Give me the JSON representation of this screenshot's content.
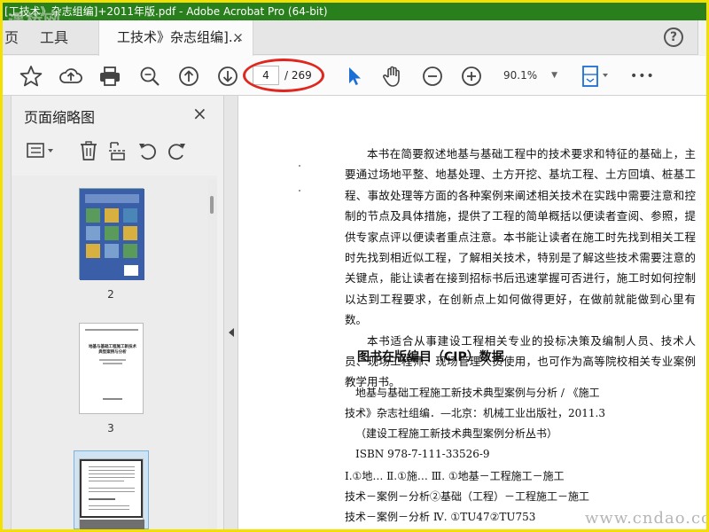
{
  "window": {
    "title": "[工技术》杂志组编]+2011年版.pdf - Adobe Acrobat Pro (64-bit)",
    "watermark_top": "遇桥网"
  },
  "tabs": {
    "home_partial": "页",
    "tools": "工具",
    "document": "工技术》杂志组编]...",
    "close": "×",
    "help": "?"
  },
  "toolbar": {
    "page_current": "4",
    "page_total": "/ 269",
    "zoom": "90.1%",
    "zoom_caret": "▼",
    "more": "•••"
  },
  "sidebar": {
    "title": "页面缩略图",
    "close": "×",
    "thumbnails": [
      {
        "label": "2"
      },
      {
        "label": "3"
      },
      {
        "label": ""
      }
    ],
    "thumb3_lines": [
      "地基与基础工程施工新技术",
      "典型案例与分析"
    ]
  },
  "document": {
    "paragraph1": "本书在简要叙述地基与基础工程中的技术要求和特征的基础上，主要通过场地平整、地基处理、土方开挖、基坑工程、土方回填、桩基工程、事故处理等方面的各种案例来阐述相关技术在实践中需要注意和控制的节点及具体措施，提供了工程的简单概括以便读者查阅、参照，提供专家点评以便读者重点注意。本书能让读者在施工时先找到相关工程时先找到相近似工程，了解相关技术，特别是了解这些技术需要注意的关键点，能让读者在接到招标书后迅速掌握可否进行，施工时如何控制以达到工程要求，在创新点上如何做得更好，在做前就能做到心里有数。",
    "paragraph2": "本书适合从事建设工程相关专业的投标决策及编制人员、技术人员、现场工程师、现场管理人员使用，也可作为高等院校相关专业案例教学用书。",
    "cip_heading": "图书在版编目（CIP）数据",
    "cip_line1": "地基与基础工程施工新技术典型案例与分析 / 《施工",
    "cip_line2": "技术》杂志社组编．—北京：机械工业出版社，2011.3",
    "cip_line3": "（建设工程施工新技术典型案例分析丛书）",
    "cip_line4": "ISBN 978-7-111-33526-9",
    "class_line1": "Ⅰ.①地…  Ⅱ.①施…  Ⅲ. ①地基－工程施工－施工",
    "class_line2": "技术－案例－分析②基础（工程）－工程施工－施工",
    "class_line3": "技术－案例－分析  Ⅳ. ①TU47②TU753"
  },
  "watermark_bottom": "www.cndao.com",
  "colors": {
    "frame": "#f2e000",
    "titlebar": "#2a7f1d",
    "annotation_red": "#e0271f",
    "select_tool_blue": "#1a6fd6",
    "cover_blue": "#3a5fa8"
  }
}
